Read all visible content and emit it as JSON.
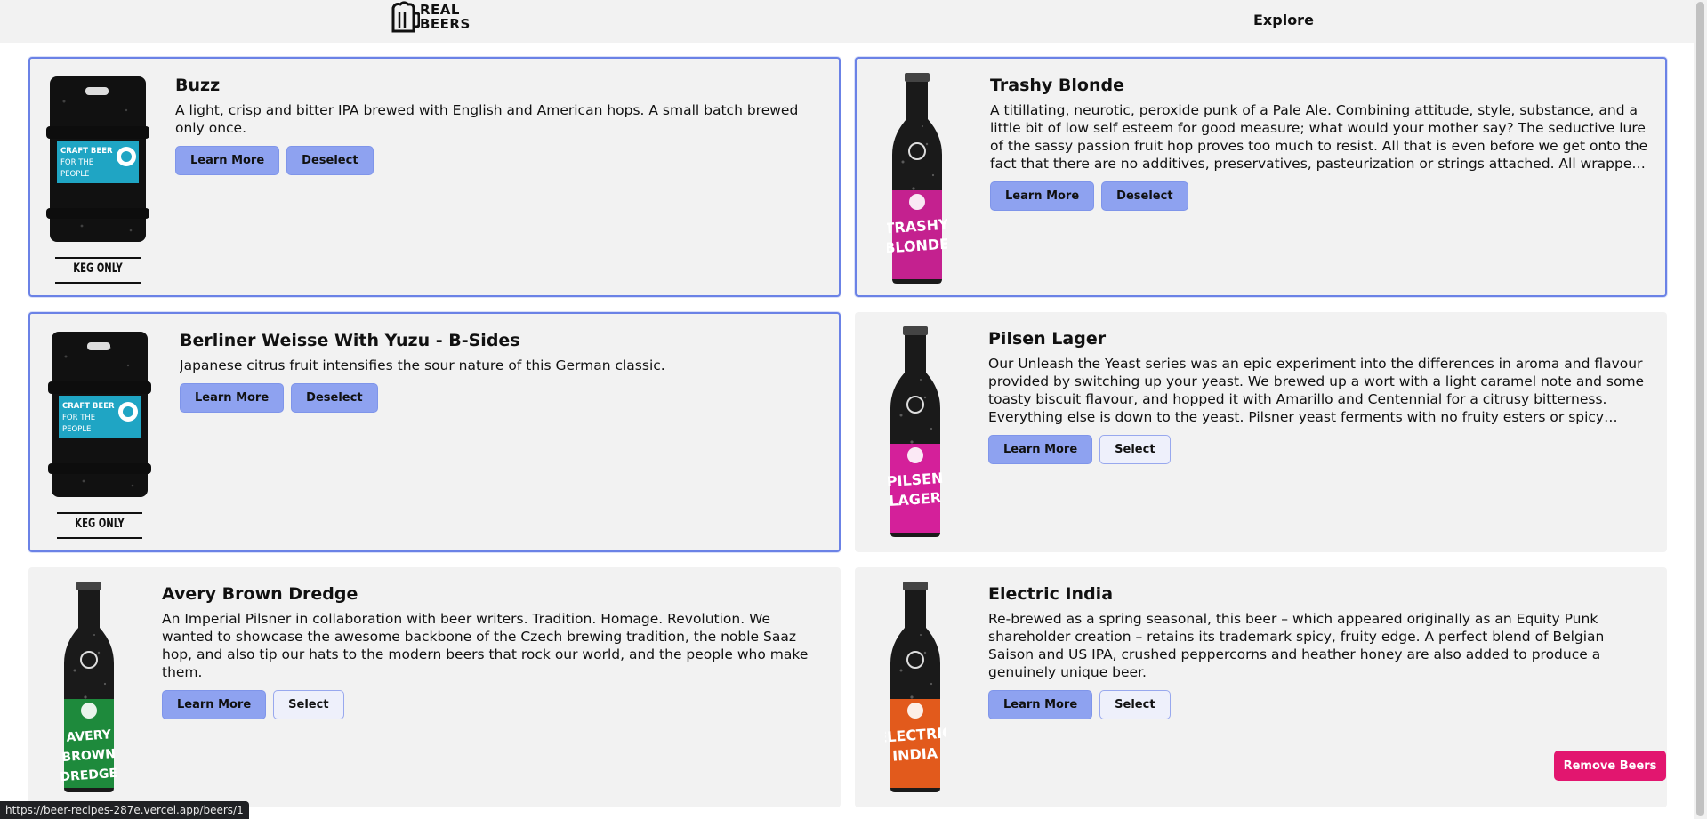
{
  "header": {
    "logo_line1": "REAL",
    "logo_line2": "BEERS",
    "nav_explore": "Explore"
  },
  "buttons": {
    "learn_more": "Learn More",
    "deselect": "Deselect",
    "select": "Select"
  },
  "beers": [
    {
      "name": "Buzz",
      "description": "A light, crisp and bitter IPA brewed with English and American hops. A small batch brewed only once.",
      "selected": true,
      "image": "keg",
      "keg_label": "KEG ONLY",
      "can_text": [
        "CRAFT BEER",
        "FOR THE",
        "PEOPLE"
      ]
    },
    {
      "name": "Trashy Blonde",
      "description": "A titillating, neurotic, peroxide punk of a Pale Ale. Combining attitude, style, substance, and a little bit of low self esteem for good measure; what would your mother say? The seductive lure of the sassy passion fruit hop proves too much to resist. All that is even before we get onto the fact that there are no additives, preservatives, pasteurization or strings attached. All wrapped up with the quintessential BrewDog bite.",
      "selected": true,
      "image": "bottle",
      "bottle_color": "#c4218f",
      "bottle_label": [
        "TRASHY",
        "BLONDE"
      ]
    },
    {
      "name": "Berliner Weisse With Yuzu - B-Sides",
      "description": "Japanese citrus fruit intensifies the sour nature of this German classic.",
      "selected": true,
      "image": "keg",
      "keg_label": "KEG ONLY",
      "can_text": [
        "CRAFT BEER",
        "FOR THE",
        "PEOPLE"
      ]
    },
    {
      "name": "Pilsen Lager",
      "description": "Our Unleash the Yeast series was an epic experiment into the differences in aroma and flavour provided by switching up your yeast. We brewed up a wort with a light caramel note and some toasty biscuit flavour, and hopped it with Amarillo and Centennial for a citrusy bitterness. Everything else is down to the yeast. Pilsner yeast ferments with no fruity esters or spicy phenols, although it can add a hint of butterscotch.",
      "selected": false,
      "image": "bottle",
      "bottle_color": "#d4209a",
      "bottle_label": [
        "PILSEN",
        "LAGER"
      ]
    },
    {
      "name": "Avery Brown Dredge",
      "description": "An Imperial Pilsner in collaboration with beer writers. Tradition. Homage. Revolution. We wanted to showcase the awesome backbone of the Czech brewing tradition, the noble Saaz hop, and also tip our hats to the modern beers that rock our world, and the people who make them.",
      "selected": false,
      "image": "bottle",
      "bottle_color": "#1e8a3c",
      "bottle_label": [
        "AVERY",
        "BROWN",
        "DREDGE"
      ]
    },
    {
      "name": "Electric India",
      "description": "Re-brewed as a spring seasonal, this beer – which appeared originally as an Equity Punk shareholder creation – retains its trademark spicy, fruity edge. A perfect blend of Belgian Saison and US IPA, crushed peppercorns and heather honey are also added to produce a genuinely unique beer.",
      "selected": false,
      "image": "bottle",
      "bottle_color": "#e25a1c",
      "bottle_label": [
        "ELECTRIC",
        "INDIA"
      ]
    }
  ],
  "remove_button": "Remove Beers",
  "status_url": "https://beer-recipes-287e.vercel.app/beers/1"
}
